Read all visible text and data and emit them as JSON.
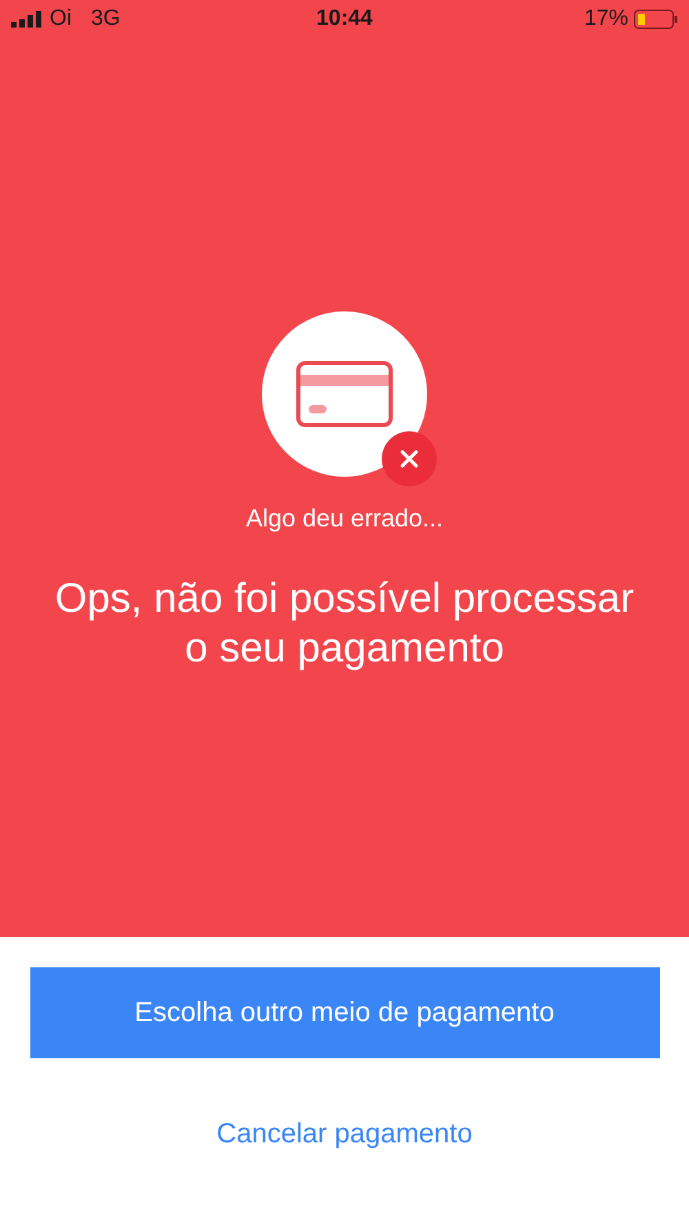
{
  "status_bar": {
    "carrier": "Oi",
    "network": "3G",
    "time": "10:44",
    "battery": "17%"
  },
  "error": {
    "subtitle": "Algo deu errado...",
    "title": "Ops, não foi possível processar o seu pagamento"
  },
  "buttons": {
    "primary": "Escolha outro meio de pagamento",
    "secondary": "Cancelar pagamento"
  }
}
